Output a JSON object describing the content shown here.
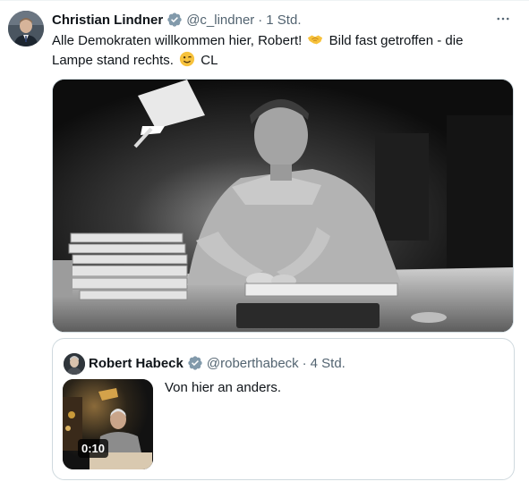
{
  "tweet": {
    "author_name": "Christian Lindner",
    "author_handle": "@c_lindner",
    "separator": "·",
    "time": "1 Std.",
    "text_part1": "Alle Demokraten willkommen hier, Robert!",
    "text_part2": "Bild fast getroffen - die Lampe stand rechts.",
    "text_part3": "CL",
    "emoji_1": "handshake-emoji",
    "emoji_2": "winking-face-emoji",
    "more_icon": "more-dots-icon",
    "verified_color": "#829aab"
  },
  "quoted_tweet": {
    "author_name": "Robert Habeck",
    "author_handle": "@roberthabeck",
    "separator": "·",
    "time": "4 Std.",
    "text": "Von hier an anders.",
    "video_duration": "0:10"
  },
  "colors": {
    "text": "#0f1419",
    "muted": "#536471",
    "border": "#cfd9de"
  }
}
